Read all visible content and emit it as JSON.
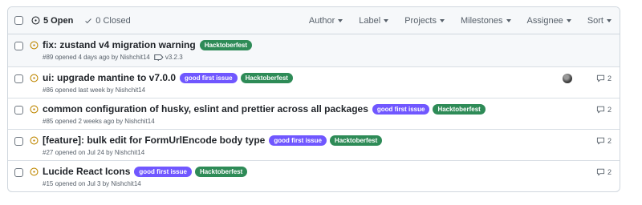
{
  "header": {
    "open_label": "5 Open",
    "closed_label": "0 Closed",
    "filters": [
      "Author",
      "Label",
      "Projects",
      "Milestones",
      "Assignee",
      "Sort"
    ]
  },
  "issues": [
    {
      "title": "fix: zustand v4 migration warning",
      "labels": [
        "Hacktoberfest"
      ],
      "meta": "#89 opened 4 days ago by Nishchit14",
      "milestone": "v3.2.3",
      "comments": ""
    },
    {
      "title": "ui: upgrade mantine to v7.0.0",
      "labels": [
        "good first issue",
        "Hacktoberfest"
      ],
      "meta": "#86 opened last week by Nishchit14",
      "comments": "2"
    },
    {
      "title": "common configuration of husky, eslint and prettier across all packages",
      "labels": [
        "good first issue",
        "Hacktoberfest"
      ],
      "meta": "#85 opened 2 weeks ago by Nishchit14",
      "comments": "2"
    },
    {
      "title": "[feature]: bulk edit for FormUrlEncode body type",
      "labels": [
        "good first issue",
        "Hacktoberfest"
      ],
      "meta": "#27 opened on Jul 24 by Nishchit14",
      "comments": "2"
    },
    {
      "title": "Lucide React Icons",
      "labels": [
        "good first issue",
        "Hacktoberfest"
      ],
      "meta": "#15 opened on Jul 3 by Nishchit14",
      "comments": "2"
    }
  ],
  "colors": {
    "open_icon": "#bf8700",
    "hacktoberfest": "#2e8b57",
    "good_first_issue": "#7057ff",
    "border": "#d0d7de"
  },
  "icons": {
    "open": "issue-opened-icon",
    "closed": "check-icon",
    "milestone": "milestone-icon",
    "comment": "comment-icon"
  }
}
